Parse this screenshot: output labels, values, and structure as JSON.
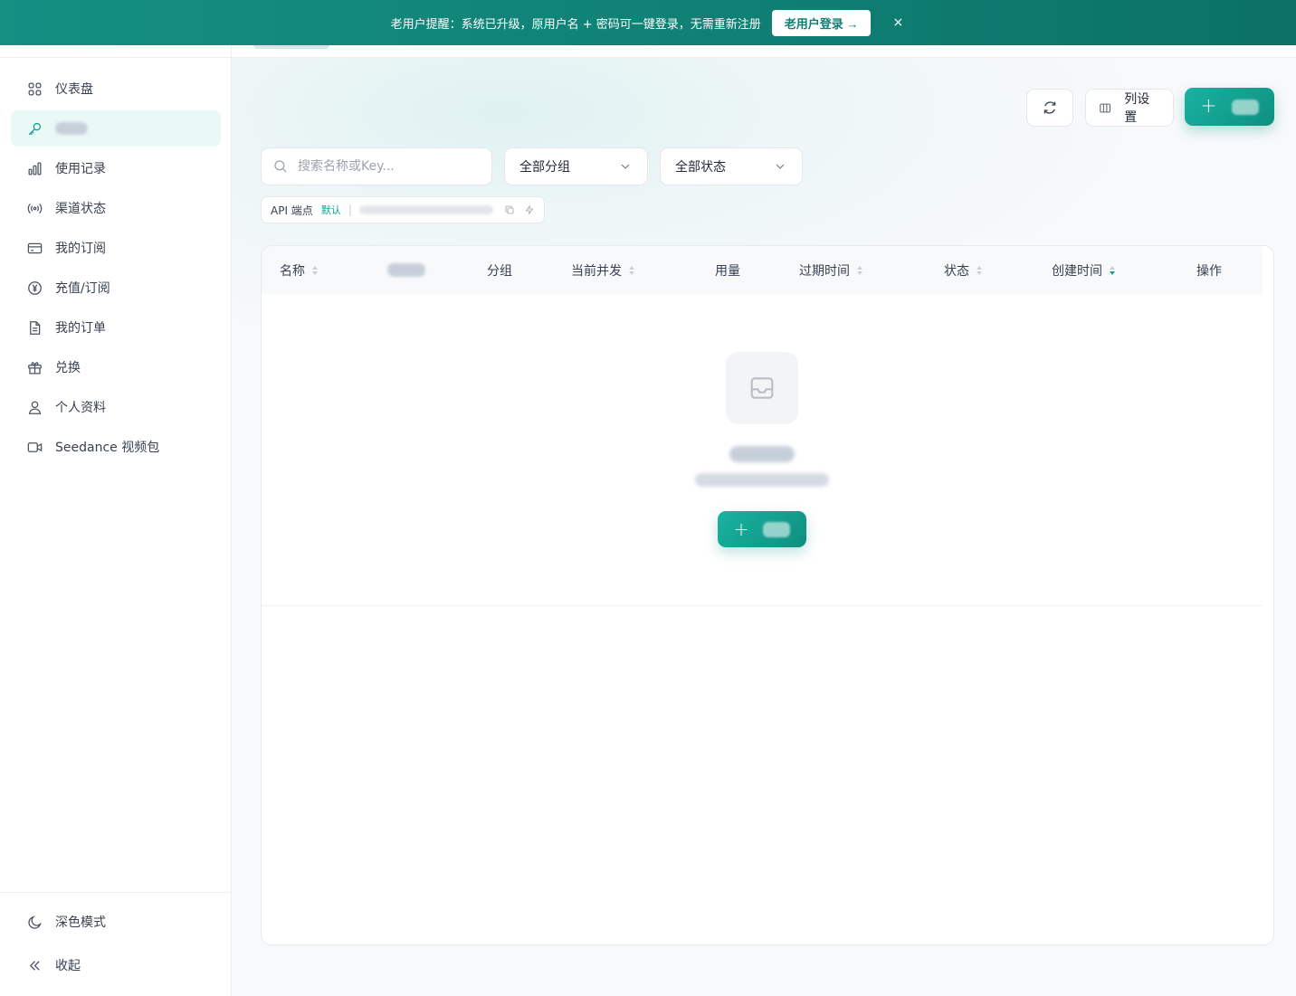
{
  "banner": {
    "text": "老用户提醒：系统已升级，原用户名 + 密码可一键登录，无需重新注册",
    "button_label": "老用户登录 →",
    "close_glyph": "×"
  },
  "sidebar": {
    "items": [
      {
        "label": "仪表盘",
        "icon": "dashboard-icon"
      },
      {
        "label": "",
        "icon": "key-icon",
        "active": true
      },
      {
        "label": "使用记录",
        "icon": "bar-chart-icon"
      },
      {
        "label": "渠道状态",
        "icon": "signal-icon"
      },
      {
        "label": "我的订阅",
        "icon": "credit-card-icon"
      },
      {
        "label": "充值/订阅",
        "icon": "yuan-icon"
      },
      {
        "label": "我的订单",
        "icon": "document-icon"
      },
      {
        "label": "兑换",
        "icon": "gift-icon"
      },
      {
        "label": "个人资料",
        "icon": "user-icon"
      },
      {
        "label": "Seedance 视频包",
        "icon": "video-icon"
      }
    ],
    "bottom": [
      {
        "label": "深色模式",
        "icon": "moon-icon"
      },
      {
        "label": "收起",
        "icon": "collapse-icon"
      }
    ]
  },
  "toolbar": {
    "column_settings_label": "列设置"
  },
  "filters": {
    "search_placeholder": "搜索名称或Key...",
    "group_select": "全部分组",
    "status_select": "全部状态"
  },
  "api_bar": {
    "label": "API 端点",
    "tag": "默认",
    "separator": "|"
  },
  "table": {
    "columns": [
      {
        "label": "名称",
        "sortable": true
      },
      {
        "label": "",
        "sortable": false
      },
      {
        "label": "分组",
        "sortable": false
      },
      {
        "label": "当前并发",
        "sortable": true
      },
      {
        "label": "用量",
        "sortable": false
      },
      {
        "label": "过期时间",
        "sortable": true
      },
      {
        "label": "状态",
        "sortable": true
      },
      {
        "label": "创建时间",
        "sortable": true,
        "sorted": "desc"
      },
      {
        "label": "操作",
        "sortable": false
      }
    ]
  },
  "colors": {
    "brand": "#12a08f",
    "banner_bg": "#0f7f73",
    "active_nav_bg": "#e9faf6"
  }
}
